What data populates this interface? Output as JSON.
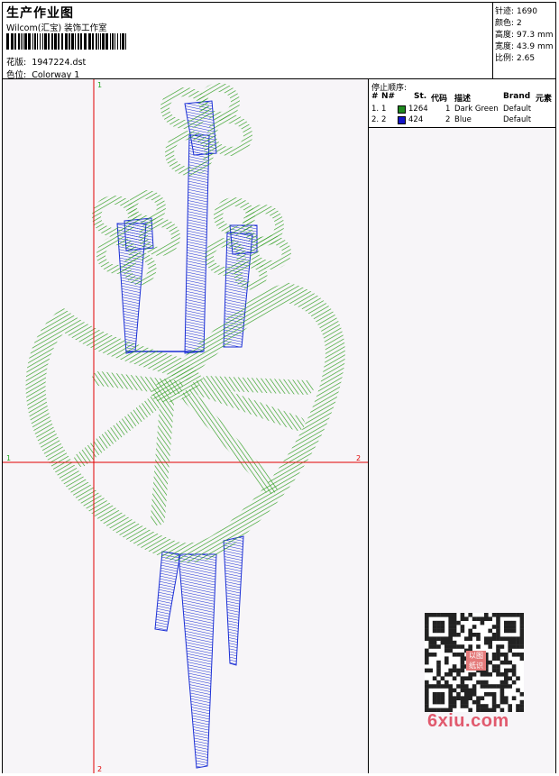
{
  "header": {
    "title": "生产作业图",
    "company": "Wilcom(汇宝) 装饰工作室",
    "design_label": "花版:",
    "design_value": "1947224.dst",
    "colorway_label": "色位:",
    "colorway_value": "Colorway 1"
  },
  "info": {
    "stitches_label": "针迹:",
    "stitches_value": "1690",
    "colors_label": "颜色:",
    "colors_value": "2",
    "height_label": "高度:",
    "height_value": "97.3 mm",
    "width_label": "宽度:",
    "width_value": "43.9 mm",
    "scale_label": "比例:",
    "scale_value": "2.65"
  },
  "canvas": {
    "axis_marks": {
      "top": "1",
      "bottom": "2",
      "left": "1",
      "right": "2"
    },
    "axis_color": "#e00000",
    "green": "#2f9e1f",
    "blue": "#1b2fd6"
  },
  "stop_sequence": {
    "title": "停止顺序:",
    "columns": [
      "#",
      "N#",
      "St.",
      "代码",
      "描述",
      "Brand",
      "元素"
    ],
    "rows": [
      {
        "num": "1.",
        "n": "1",
        "color": "#1f8a1f",
        "stitches": "1264",
        "code": "1",
        "description": "Dark Green",
        "brand": "Default"
      },
      {
        "num": "2.",
        "n": "2",
        "color": "#1414c8",
        "stitches": "424",
        "code": "2",
        "description": "Blue",
        "brand": "Default"
      }
    ]
  },
  "watermark": {
    "stamp_text": "以图纸识",
    "text": "6xiu.com"
  }
}
